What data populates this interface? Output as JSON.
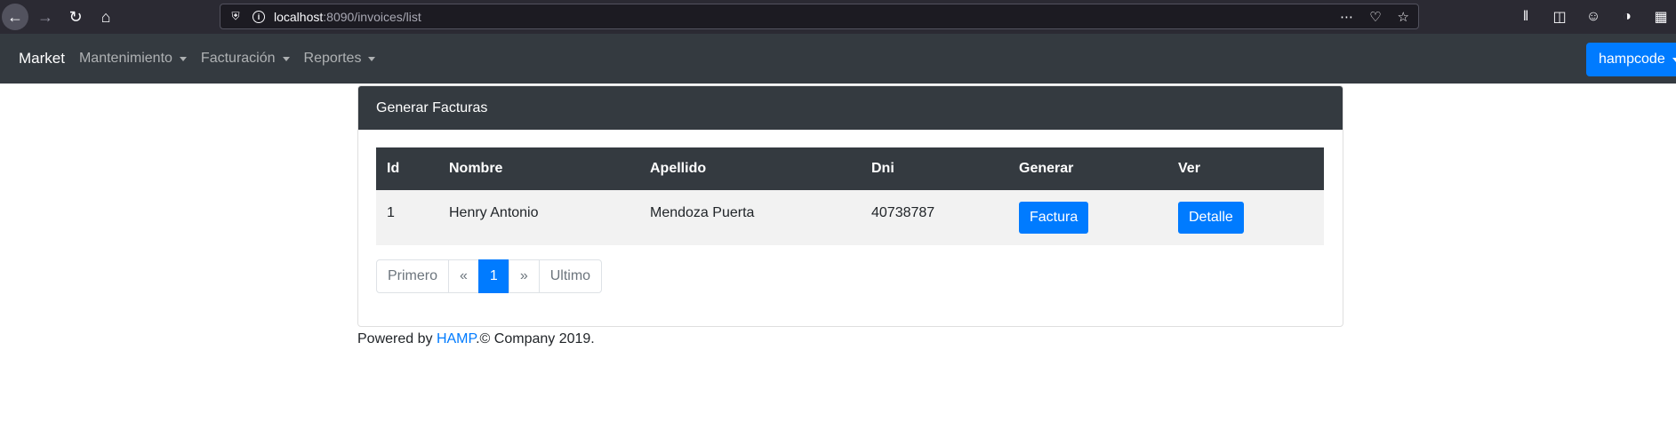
{
  "browser": {
    "url_host": "localhost",
    "url_rest": ":8090/invoices/list"
  },
  "navbar": {
    "brand": "Market",
    "items": [
      "Mantenimiento",
      "Facturación",
      "Reportes"
    ],
    "user": "hampcode"
  },
  "card": {
    "title": "Generar Facturas",
    "columns": [
      "Id",
      "Nombre",
      "Apellido",
      "Dni",
      "Generar",
      "Ver"
    ],
    "rows": [
      {
        "id": "1",
        "nombre": "Henry Antonio",
        "apellido": "Mendoza Puerta",
        "dni": "40738787",
        "generar": "Factura",
        "ver": "Detalle"
      }
    ]
  },
  "pagination": {
    "first": "Primero",
    "prev": "«",
    "current": "1",
    "next": "»",
    "last": "Ultimo"
  },
  "footer": {
    "prefix": "Powered by ",
    "link": "HAMP",
    "suffix": ".© Company 2019."
  },
  "colors": {
    "navbar": "#343a40",
    "primary": "#007bff"
  }
}
